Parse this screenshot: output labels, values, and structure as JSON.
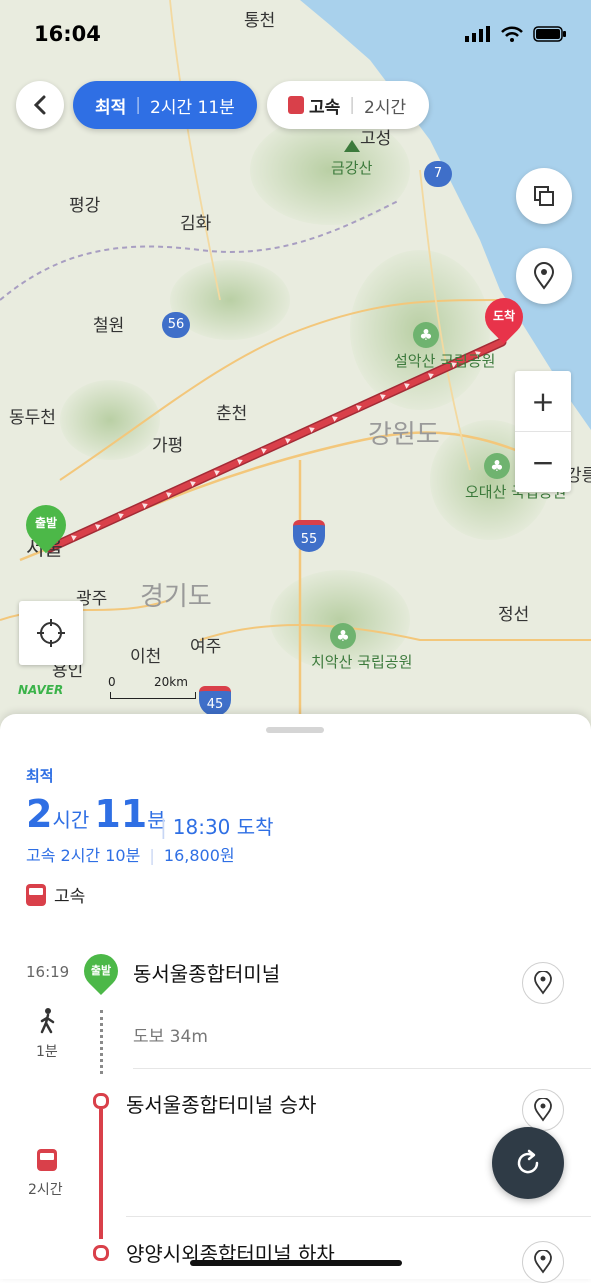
{
  "status_bar": {
    "time": "16:04"
  },
  "route_tabs": [
    {
      "label": "최적",
      "duration": "2시간 11분",
      "selected": true
    },
    {
      "label": "고속",
      "duration": "2시간",
      "selected": false
    }
  ],
  "map": {
    "labels": [
      "통천",
      "고성",
      "금강산",
      "평강",
      "김화",
      "철원",
      "동두천",
      "춘천",
      "가평",
      "서울",
      "광주",
      "이천",
      "여주",
      "용인",
      "정선",
      "강릉"
    ],
    "region_labels": [
      "강원도",
      "경기도"
    ],
    "parks": [
      "설악산 국립공원",
      "오대산 국립공원",
      "치악산 국립공원"
    ],
    "highways": [
      "7",
      "56",
      "55",
      "45"
    ],
    "markers": {
      "start": "출발",
      "end": "도착"
    },
    "scale": {
      "zero": "0",
      "distance": "20km"
    },
    "logo": "NAVER"
  },
  "summary": {
    "tag": "최적",
    "hours": "2",
    "hours_unit": "시간",
    "minutes": "11",
    "minutes_unit": "분",
    "arrival": "18:30 도착",
    "sub_mode": "고속 2시간 10분",
    "fare": "16,800원",
    "mode_label": "고속"
  },
  "steps": [
    {
      "time": "16:19",
      "marker": "출발",
      "title": "동서울종합터미널",
      "walk_text": "도보 34m",
      "duration": "1분"
    },
    {
      "title": "동서울종합터미널 승차",
      "duration": "2시간"
    },
    {
      "title": "양양시외종합터미널 하차"
    }
  ],
  "colors": {
    "accent": "#2f6fe4",
    "bus_red": "#d9404a",
    "start_green": "#4cb848",
    "end_red": "#e8334a"
  }
}
